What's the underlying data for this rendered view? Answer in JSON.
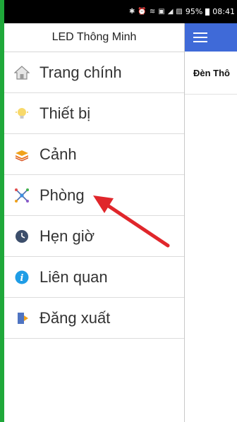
{
  "status_bar": {
    "battery": "95%",
    "time": "08:41"
  },
  "drawer": {
    "title": "LED Thông Minh",
    "items": [
      {
        "label": "Trang chính",
        "icon": "home-icon"
      },
      {
        "label": "Thiết bị",
        "icon": "lightbulb-icon"
      },
      {
        "label": "Cảnh",
        "icon": "layers-icon"
      },
      {
        "label": "Phòng",
        "icon": "network-icon"
      },
      {
        "label": "Hẹn giờ",
        "icon": "clock-icon"
      },
      {
        "label": "Liên quan",
        "icon": "info-icon"
      },
      {
        "label": "Đăng xuất",
        "icon": "logout-icon"
      }
    ]
  },
  "main": {
    "title": "Đèn Thô"
  },
  "colors": {
    "appbar": "#3f6ad8",
    "frame_border": "#1fa83a",
    "arrow": "#e0262b"
  }
}
